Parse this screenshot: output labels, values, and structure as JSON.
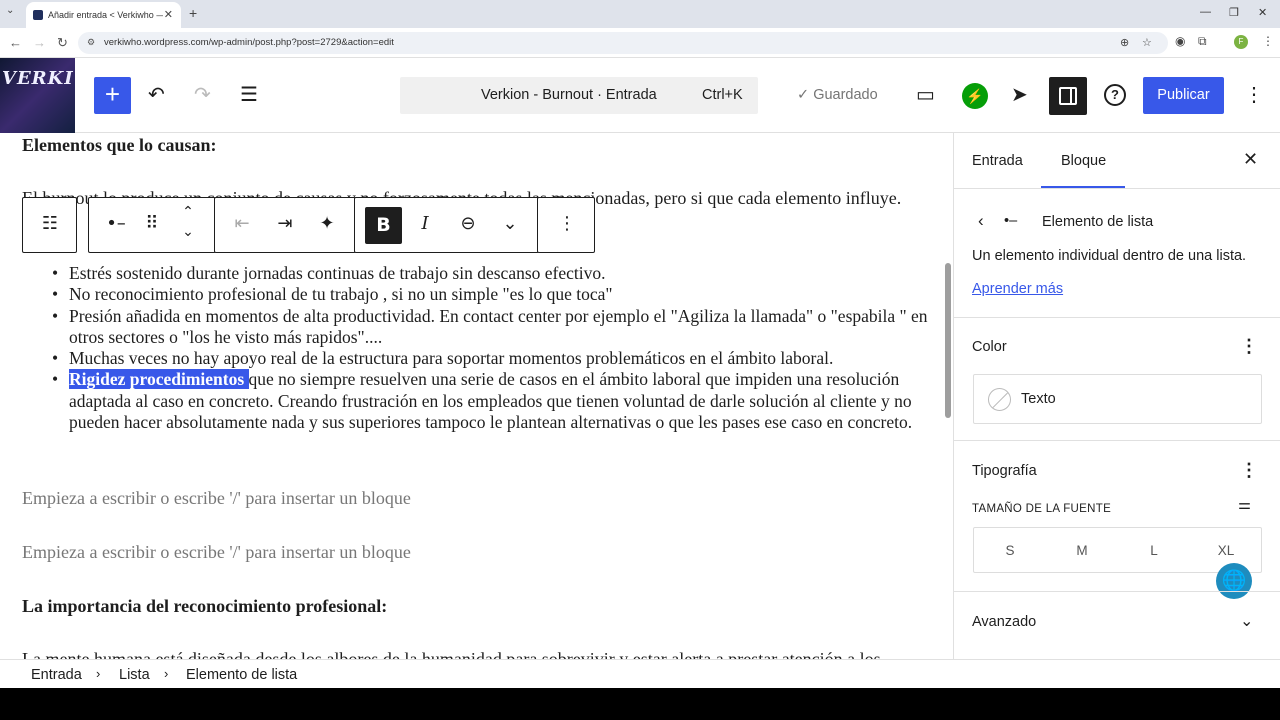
{
  "browser": {
    "tab_title": "Añadir entrada < Verkiwho — W",
    "url": "verkiwho.wordpress.com/wp-admin/post.php?post=2729&action=edit",
    "profile_initial": "F"
  },
  "header": {
    "site_logo_text": "VERKI",
    "doc_title": "Verkion - Burnout · Entrada",
    "shortcut": "Ctrl+K",
    "saved_label": "Guardado",
    "publish_label": "Publicar"
  },
  "editor": {
    "heading1": "Elementos que lo causan:",
    "intro": "El burnout lo produce un conjunto de causas y no forzosamente todas las mencionadas, pero si que cada elemento influye.",
    "list": [
      "Estrés sostenido durante jornadas continuas de trabajo sin descanso efectivo.",
      "No reconocimiento profesional de tu trabajo , si no un simple \"es lo que toca\"",
      "Presión añadida en momentos de alta productividad. En contact center por ejemplo el \"Agiliza la llamada\" o \"espabila \" en otros sectores o \"los he visto más rapidos\"....",
      "Muchas veces no hay apoyo real de la estructura para soportar momentos problemáticos en el ámbito laboral."
    ],
    "last_item_highlight": "Rigidez procedimientos ",
    "last_item_rest": "que no siempre resuelven una serie de casos en el ámbito laboral que impiden una resolución adaptada al caso en concreto. Creando frustración  en los empleados que tienen voluntad de darle solución al cliente y no pueden hacer absolutamente nada y sus superiores tampoco le plantean alternativas o que les pases ese caso en concreto.",
    "placeholder1": "Empieza a escribir o escribe '/' para insertar un bloque",
    "placeholder2": "Empieza a escribir o escribe '/' para insertar un bloque",
    "heading2": "La importancia del reconocimiento profesional:",
    "partial_para": "La mente humana está diseñada desde los albores de la humanidad para sobrevivir y estar alerta a prestar atención a los"
  },
  "sidebar": {
    "tab_post": "Entrada",
    "tab_block": "Bloque",
    "block_name": "Elemento de lista",
    "block_desc": "Un elemento individual dentro de una lista.",
    "learn_more": "Aprender más",
    "color_title": "Color",
    "color_text": "Texto",
    "typo_title": "Tipografía",
    "font_size_label": "TAMAÑO DE LA FUENTE",
    "sizes": [
      "S",
      "M",
      "L",
      "XL"
    ],
    "advanced": "Avanzado"
  },
  "breadcrumbs": [
    "Entrada",
    "Lista",
    "Elemento de lista"
  ],
  "colors": {
    "accent": "#3858e9",
    "jetpack": "#069e08"
  }
}
